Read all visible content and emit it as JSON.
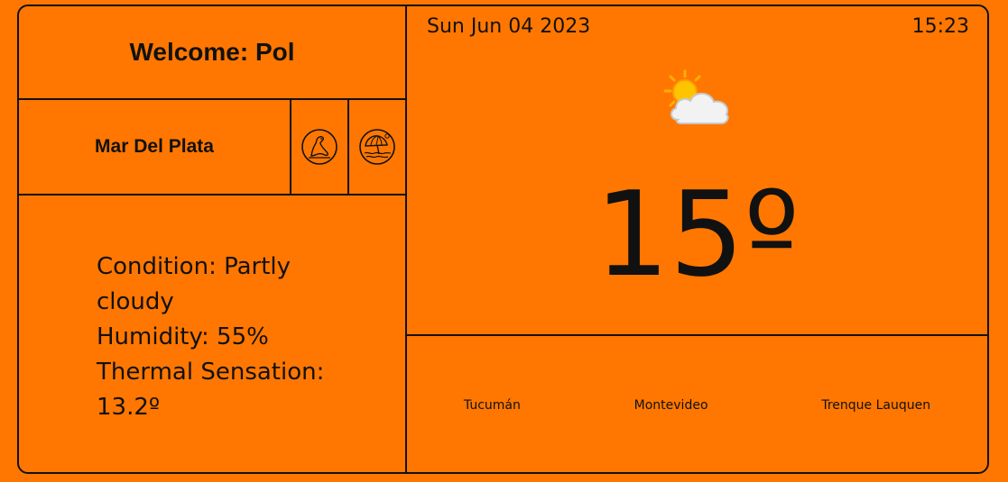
{
  "welcome": {
    "text": "Welcome: Pol"
  },
  "location": {
    "city": "Mar Del Plata",
    "icons": [
      "sea-lion-icon",
      "beach-umbrella-icon"
    ]
  },
  "details": {
    "condition": "Condition: Partly cloudy",
    "humidity": "Humidity: 55%",
    "thermal": "Thermal Sensation: 13.2º"
  },
  "header": {
    "date": "Sun Jun 04 2023",
    "time": "15:23"
  },
  "weather": {
    "icon": "partly-cloudy-icon",
    "temperature": "15º"
  },
  "other_cities": [
    "Tucumán",
    "Montevideo",
    "Trenque Lauquen"
  ],
  "colors": {
    "background": "#ff7700",
    "border": "#111111",
    "sun": "#ffc400",
    "cloud": "#f2f2f2"
  }
}
